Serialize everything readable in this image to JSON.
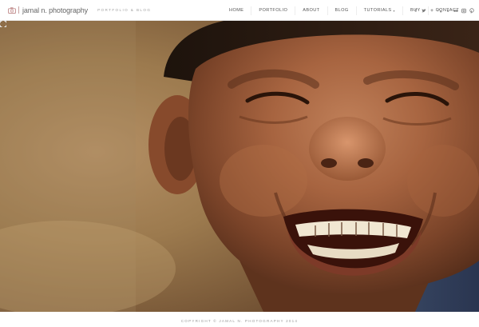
{
  "header": {
    "logo_text": "jamal n. photography",
    "tagline": "PORTFOLIO & BLOG"
  },
  "nav": {
    "items": [
      {
        "label": "HOME"
      },
      {
        "label": "PORTFOLIO"
      },
      {
        "label": "ABOUT"
      },
      {
        "label": "BLOG"
      },
      {
        "label": "TUTORIALS"
      },
      {
        "label": "BUY"
      },
      {
        "label": "CONTACT"
      }
    ]
  },
  "social": {
    "icons": [
      "facebook-icon",
      "twitter-icon",
      "google-plus-icon",
      "stumbleupon-icon",
      "500px-icon",
      "flickr-icon",
      "instagram-icon",
      "pinterest-icon"
    ]
  },
  "hero": {
    "image_subject": "smiling-child-portrait"
  },
  "footer": {
    "copyright": "COPYRIGHT © JAMAL N. PHOTOGRAPHY 2014"
  },
  "colors": {
    "header_bg": "#ffffff",
    "nav_text": "#555555",
    "accent": "#c9a3a3",
    "skin": "#7a4a2c"
  }
}
